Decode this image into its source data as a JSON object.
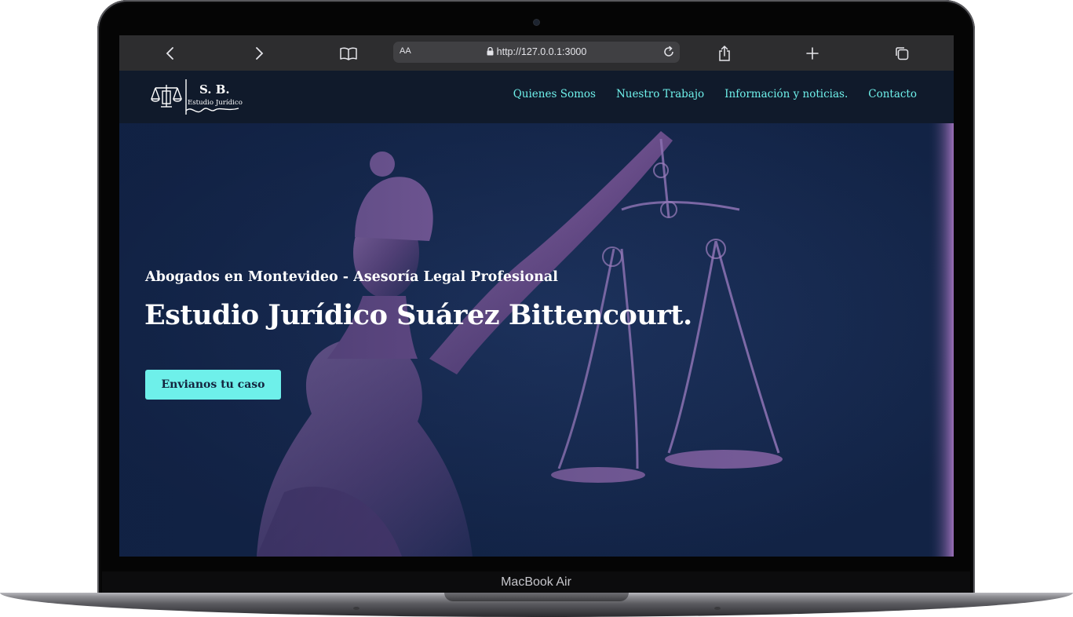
{
  "device": {
    "label": "MacBook Air"
  },
  "browser": {
    "text_size_label": "AA",
    "url": "http://127.0.0.1:3000"
  },
  "site": {
    "logo": {
      "initials": "S. B.",
      "subtitle": "Estudio Jurídico"
    },
    "nav": [
      {
        "label": "Quienes Somos"
      },
      {
        "label": "Nuestro Trabajo"
      },
      {
        "label": "Información y noticias."
      },
      {
        "label": "Contacto"
      }
    ],
    "hero": {
      "kicker": "Abogados en Montevideo - Asesoría Legal Profesional",
      "headline": "Estudio Jurídico Suárez Bittencourt.",
      "cta_label": "Envianos tu caso"
    },
    "colors": {
      "accent": "#6ef0ea",
      "navbar": "#101a2b",
      "hero_dark": "#14253f",
      "hero_highlight": "#b283c8"
    }
  }
}
